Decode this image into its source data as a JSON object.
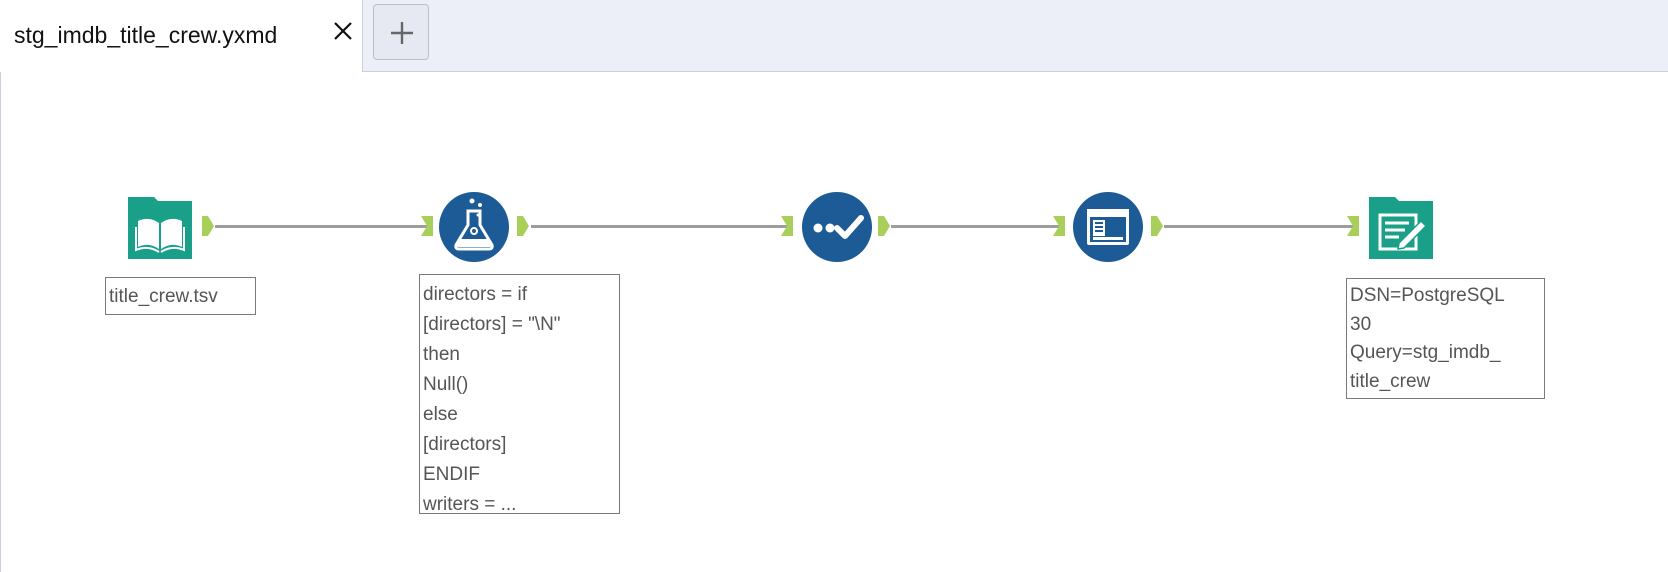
{
  "tab": {
    "title": "stg_imdb_title_crew.yxmd"
  },
  "workflow": {
    "tools": [
      {
        "name": "Input Data",
        "icon": "book-icon",
        "annotation": "title_crew.tsv"
      },
      {
        "name": "Formula",
        "icon": "flask-icon",
        "annotation": "directors = if\n[directors] = \"\\N\"\nthen\nNull()\nelse\n[directors]\nENDIF\nwriters = ..."
      },
      {
        "name": "Select",
        "icon": "check-icon",
        "annotation": ""
      },
      {
        "name": "Data Cleansing",
        "icon": "window-icon",
        "annotation": ""
      },
      {
        "name": "Output Data",
        "icon": "output-icon",
        "annotation": "DSN=PostgreSQL\n30\nQuery=stg_imdb_\ntitle_crew"
      }
    ]
  },
  "colors": {
    "input_output": "#1aa089",
    "process_blue": "#1c5b96",
    "anchor": "#a9cf5b",
    "connection": "#9d9d9d"
  }
}
